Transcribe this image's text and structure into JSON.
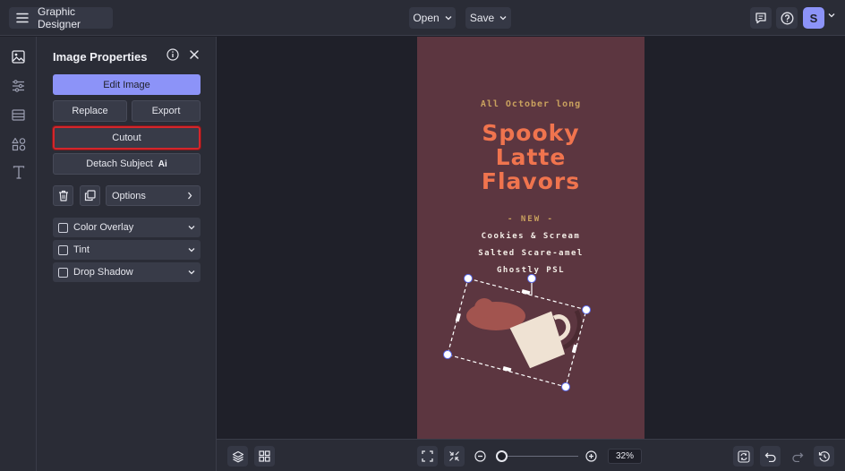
{
  "app": {
    "menu_label": "Graphic Designer",
    "open_label": "Open",
    "save_label": "Save",
    "avatar_initial": "S",
    "accent_color": "#8c93f8"
  },
  "rail": {
    "items": [
      "image-icon",
      "sliders-icon",
      "background-icon",
      "shapes-icon",
      "text-icon"
    ]
  },
  "panel": {
    "title": "Image Properties",
    "edit_image": "Edit Image",
    "replace": "Replace",
    "export": "Export",
    "cutout": "Cutout",
    "detach_subject": "Detach Subject",
    "ai_badge": "Ai",
    "options": "Options",
    "accordions": [
      {
        "label": "Color Overlay",
        "checked": false
      },
      {
        "label": "Tint",
        "checked": false
      },
      {
        "label": "Drop Shadow",
        "checked": false
      }
    ],
    "highlight_color": "#d3262b"
  },
  "canvas": {
    "background": "#5c3640",
    "pre_title": "All October long",
    "title_lines": [
      "Spooky",
      "Latte",
      "Flavors"
    ],
    "new_label": "- NEW -",
    "menu_items": [
      "Cookies & Scream",
      "Salted Scare-amel",
      "Ghostly PSL"
    ]
  },
  "bottom": {
    "zoom": "32%"
  }
}
